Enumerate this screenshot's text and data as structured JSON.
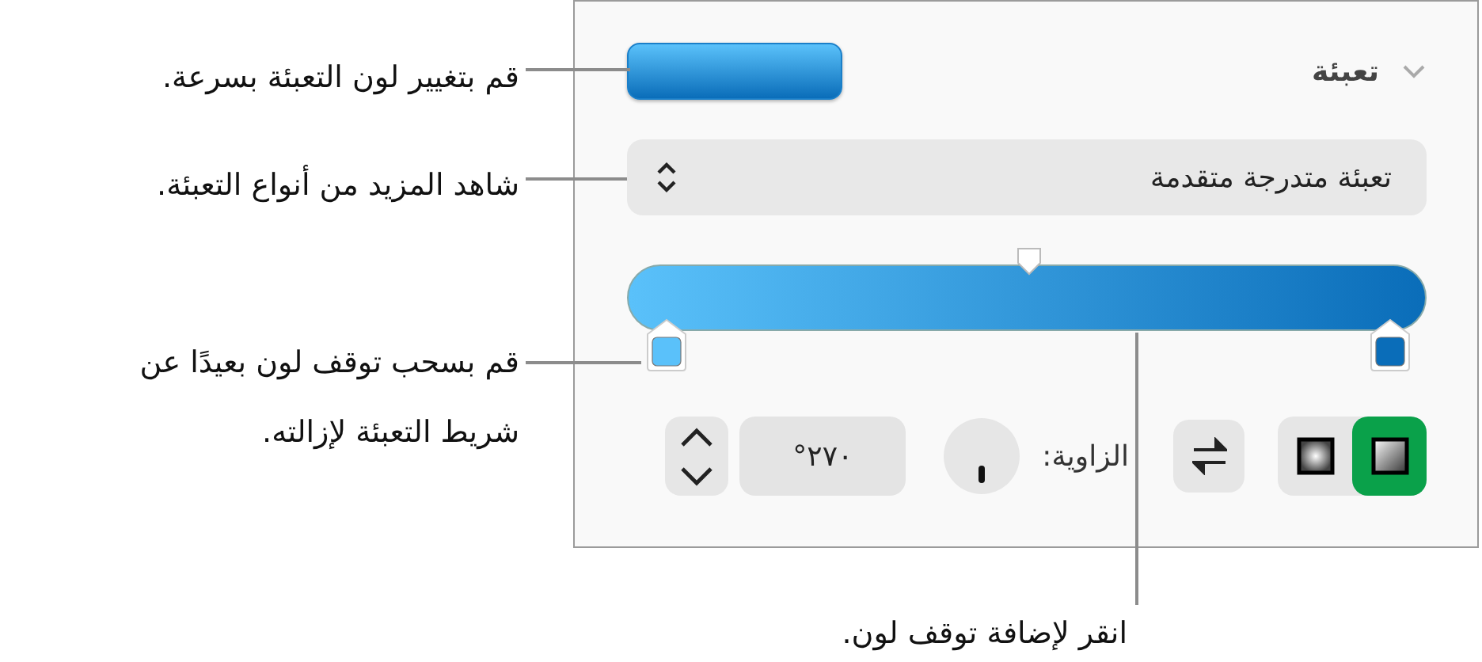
{
  "panel": {
    "section_title": "تعبئة",
    "expanded": true,
    "fill_type": "تعبئة متدرجة متقدمة",
    "gradient_stops": [
      {
        "color": "#5ac1fa"
      },
      {
        "color": "#0a6db9"
      }
    ],
    "gradient_types": [
      {
        "kind": "linear",
        "selected": true
      },
      {
        "kind": "radial",
        "selected": false
      }
    ],
    "angle_label": "الزاوية:",
    "angle_value": "٢٧٠°"
  },
  "callouts": [
    {
      "text": "قم بتغيير لون التعبئة بسرعة."
    },
    {
      "text": "شاهد المزيد من أنواع التعبئة."
    },
    {
      "text": "قم بسحب توقف لون بعيدًا عن شريط التعبئة لإزالته."
    },
    {
      "text": "انقر لإضافة توقف لون."
    }
  ]
}
